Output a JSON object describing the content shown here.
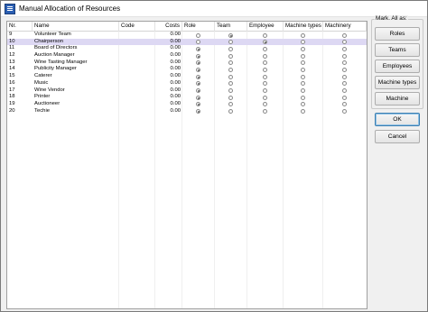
{
  "window": {
    "title": "Manual Allocation of Resources"
  },
  "table": {
    "columns": [
      "Nr.",
      "Name",
      "Code",
      "Costs",
      "Role",
      "Team",
      "Employee",
      "Machine types",
      "Machinery"
    ],
    "rows": [
      {
        "nr": "9",
        "name": "Volunteer Team",
        "code": "",
        "costs": "0.00",
        "selected": "team",
        "highlight": false
      },
      {
        "nr": "10",
        "name": "Chairperson",
        "code": "",
        "costs": "0.00",
        "selected": "employee",
        "highlight": true
      },
      {
        "nr": "11",
        "name": "Board of Directors",
        "code": "",
        "costs": "0.00",
        "selected": "role",
        "highlight": false
      },
      {
        "nr": "12",
        "name": "Auction Manager",
        "code": "",
        "costs": "0.00",
        "selected": "role",
        "highlight": false
      },
      {
        "nr": "13",
        "name": "Wine Tasting Manager",
        "code": "",
        "costs": "0.00",
        "selected": "role",
        "highlight": false
      },
      {
        "nr": "14",
        "name": "Publicity Manager",
        "code": "",
        "costs": "0.00",
        "selected": "role",
        "highlight": false
      },
      {
        "nr": "15",
        "name": "Caterer",
        "code": "",
        "costs": "0.00",
        "selected": "role",
        "highlight": false
      },
      {
        "nr": "16",
        "name": "Music",
        "code": "",
        "costs": "0.00",
        "selected": "role",
        "highlight": false
      },
      {
        "nr": "17",
        "name": "Wine Vendor",
        "code": "",
        "costs": "0.00",
        "selected": "role",
        "highlight": false
      },
      {
        "nr": "18",
        "name": "Printer",
        "code": "",
        "costs": "0.00",
        "selected": "role",
        "highlight": false
      },
      {
        "nr": "19",
        "name": "Auctioneer",
        "code": "",
        "costs": "0.00",
        "selected": "role",
        "highlight": false
      },
      {
        "nr": "20",
        "name": "Techie",
        "code": "",
        "costs": "0.00",
        "selected": "role",
        "highlight": false
      }
    ]
  },
  "mark_all": {
    "legend": "Mark. All as:",
    "buttons": [
      "Roles",
      "Teams",
      "Employees",
      "Machine types",
      "Machine"
    ]
  },
  "dialog_buttons": {
    "ok": "OK",
    "cancel": "Cancel"
  },
  "colors": {
    "selected_row": "#ddd8f3",
    "default_button_border": "#3c7fb1"
  }
}
